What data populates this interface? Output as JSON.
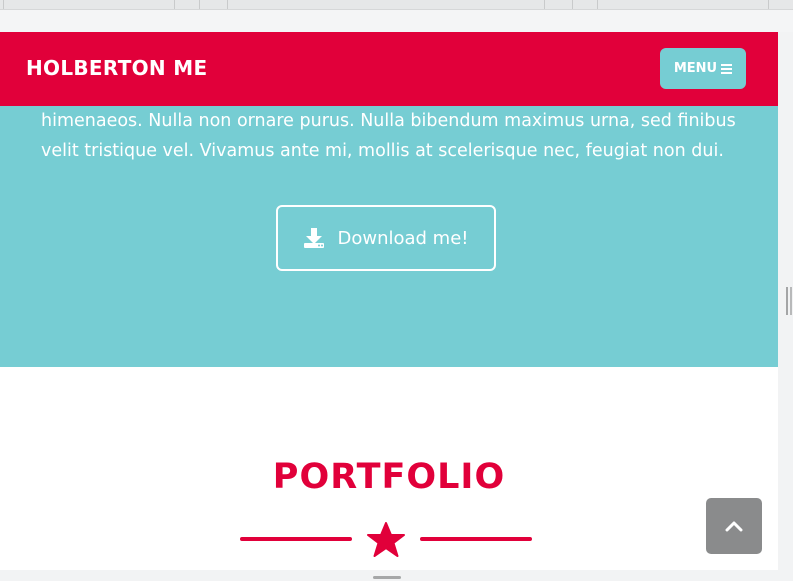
{
  "navbar": {
    "brand": "HOLBERTON ME",
    "menu_label": "MENU",
    "menu_icon": "hamburger-icon"
  },
  "about": {
    "text": "himenaeos. Nulla non ornare purus. Nulla bibendum maximus urna, sed finibus velit tristique vel. Vivamus ante mi, mollis at scelerisque nec, feugiat non dui.",
    "download_label": "Download me!",
    "download_icon": "download-icon"
  },
  "portfolio": {
    "title": "PORTFOLIO",
    "divider_icon": "star-icon"
  },
  "scroll_top": {
    "icon": "chevron-up-icon"
  },
  "colors": {
    "primary": "#e1003a",
    "secondary": "#76cdd3",
    "scroll_button": "#8a8b8c"
  }
}
